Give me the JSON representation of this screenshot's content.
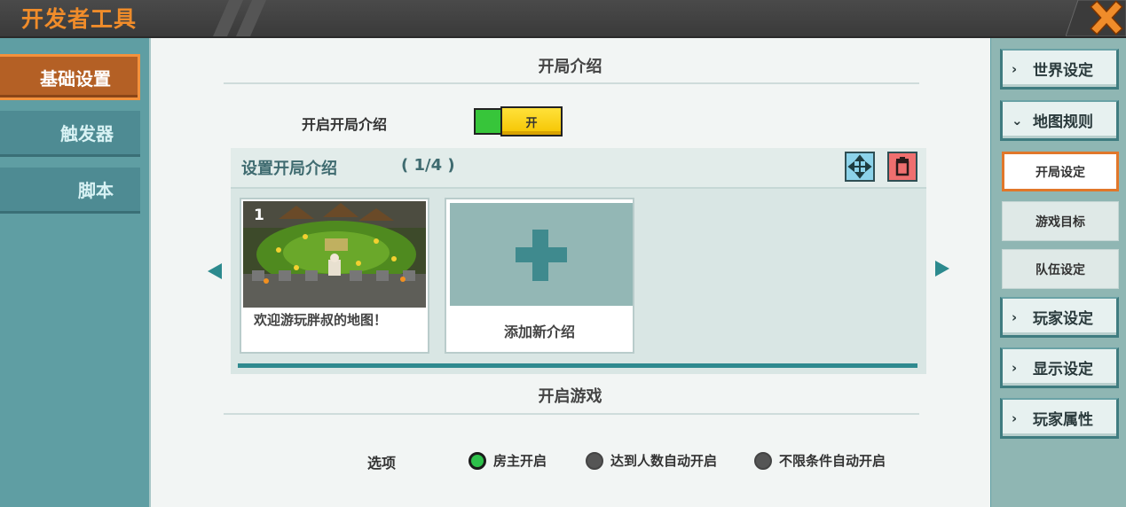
{
  "window": {
    "title": "开发者工具"
  },
  "left_nav": {
    "items": [
      {
        "label": "基础设置",
        "active": true
      },
      {
        "label": "触发器",
        "active": false
      },
      {
        "label": "脚本",
        "active": false
      }
    ]
  },
  "main": {
    "section1_title": "开局介绍",
    "enable_intro_label": "开启开局介绍",
    "toggle_label": "开",
    "toggle_on": true,
    "intro": {
      "title": "设置开局介绍",
      "count": "( 1/4 )",
      "cards": [
        {
          "number": "1",
          "caption": "欢迎游玩胖叔的地图！"
        },
        {
          "caption": "添加新介绍"
        }
      ]
    },
    "section2_title": "开启游戏",
    "options_label": "选项",
    "radio_options": [
      {
        "label": "房主开启",
        "selected": true
      },
      {
        "label": "达到人数自动开启",
        "selected": false
      },
      {
        "label": "不限条件自动开启",
        "selected": false
      }
    ]
  },
  "right_nav": {
    "items": [
      {
        "label": "世界设定",
        "chevron": "chevron-right-icon"
      },
      {
        "label": "地图规则",
        "chevron": "chevron-down-icon"
      },
      {
        "label": "开局设定",
        "sub": true,
        "active": true
      },
      {
        "label": "游戏目标",
        "sub": true,
        "active": false
      },
      {
        "label": "队伍设定",
        "sub": true,
        "active": false
      },
      {
        "label": "玩家设定",
        "chevron": "chevron-right-icon"
      },
      {
        "label": "显示设定",
        "chevron": "chevron-right-icon"
      },
      {
        "label": "玩家属性",
        "chevron": "chevron-right-icon"
      }
    ]
  },
  "colors": {
    "accent_orange": "#f08c2a",
    "teal": "#2c8a8e",
    "toggle_yellow": "#ffe13a",
    "toggle_green": "#37c53a"
  }
}
